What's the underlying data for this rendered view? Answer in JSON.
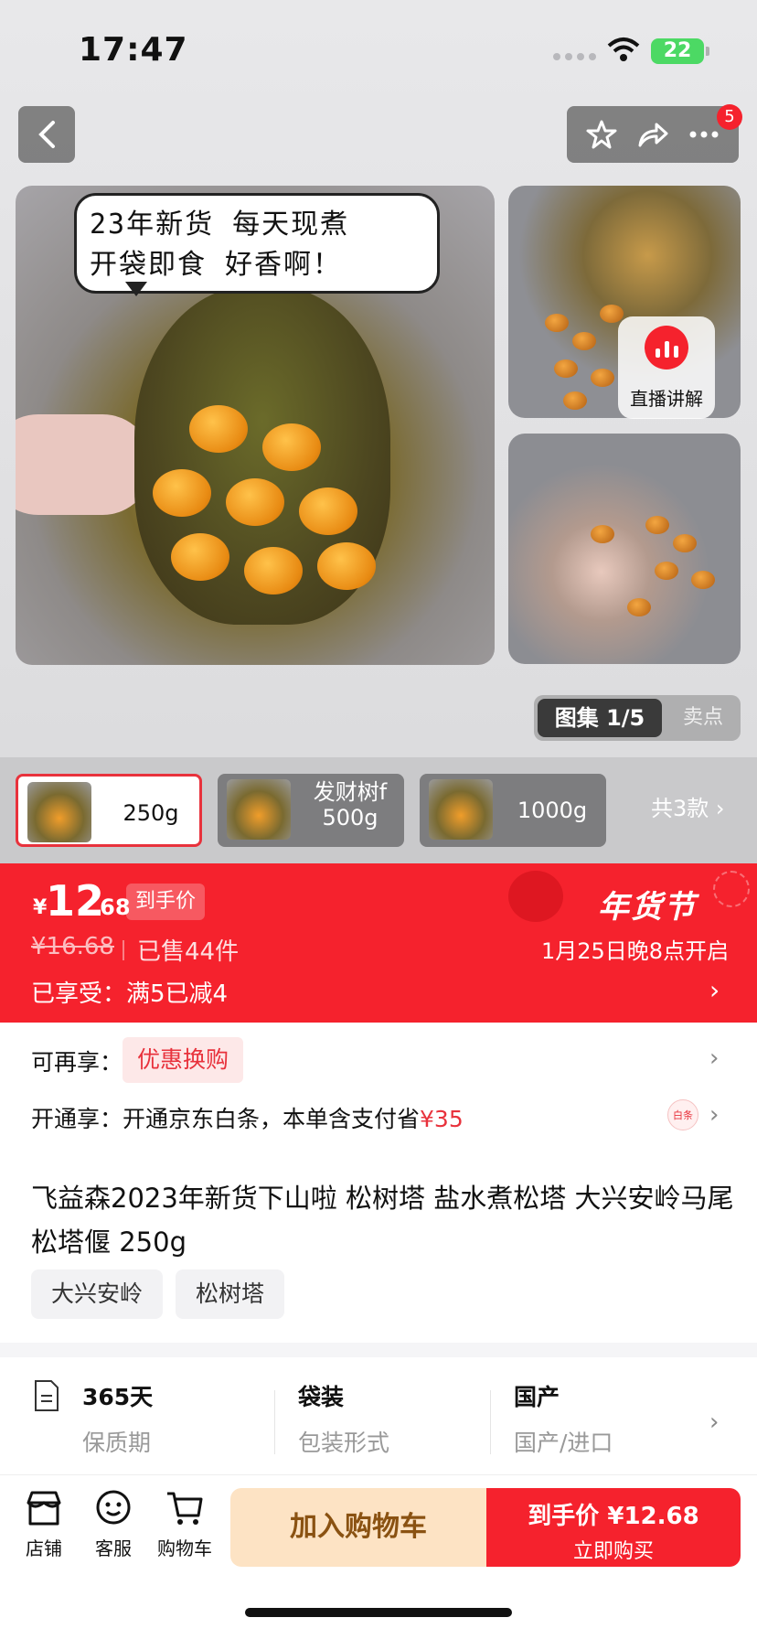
{
  "status_bar": {
    "time": "17:47",
    "battery": "22"
  },
  "header": {
    "notification_count": "5"
  },
  "gallery": {
    "bubble_line1": "23年新货 每天现煮",
    "bubble_line2": "开袋即食 好香啊！",
    "live_label": "直播讲解",
    "album_label": "图集 1/5",
    "selling_points_label": "卖点"
  },
  "variants": {
    "items": [
      {
        "label": "250g"
      },
      {
        "promo": "发财树f",
        "label": "500g"
      },
      {
        "label": "1000g"
      }
    ],
    "count_label": "共3款"
  },
  "price": {
    "currency": "¥",
    "integer": "12",
    "decimal": ".68",
    "tag": "到手价",
    "original": "¥16.68",
    "sold": "已售44件",
    "enjoyed": "已享受：满5已减4",
    "festival": "年货节",
    "festival_date": "1月25日晚8点开启"
  },
  "offers": {
    "row1_label": "可再享：",
    "row1_tag": "优惠换购",
    "row2_label": "开通享：开通京东白条，本单含支付省",
    "row2_amount": "¥35",
    "baitiao_icon_text": "白条"
  },
  "product": {
    "title": "飞益森2023年新货下山啦 松树塔 盐水煮松塔 大兴安岭马尾松塔偃 250g",
    "chips": [
      "大兴安岭",
      "松树塔"
    ]
  },
  "specs": [
    {
      "value": "365天",
      "key": "保质期"
    },
    {
      "value": "袋装",
      "key": "包装形式"
    },
    {
      "value": "国产",
      "key": "国产/进口"
    }
  ],
  "bottom_bar": {
    "shop": "店铺",
    "service": "客服",
    "cart": "购物车",
    "add_to_cart": "加入购物车",
    "buy_price_label": "到手价 ¥12.68",
    "buy_now": "立即购买"
  },
  "colors": {
    "accent": "#f5222d",
    "cart_bg": "#fde3c4",
    "cart_text": "#8a5212"
  }
}
